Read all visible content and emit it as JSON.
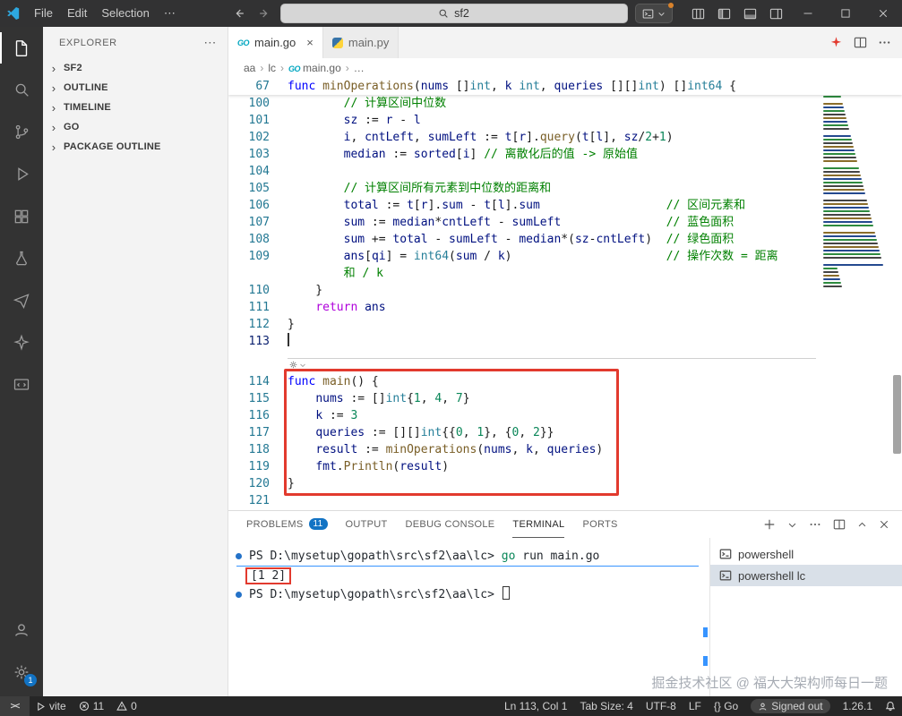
{
  "colors": {
    "annotation_red": "#e23a2e",
    "badge_blue": "#1273c4",
    "accent_blue": "#3794ff"
  },
  "title_bar": {
    "menus": [
      "File",
      "Edit",
      "Selection",
      "⋯"
    ],
    "search": "sf2"
  },
  "activity_bar": {
    "top": [
      {
        "name": "explorer",
        "active": true
      },
      {
        "name": "search"
      },
      {
        "name": "source-control"
      },
      {
        "name": "run-debug"
      },
      {
        "name": "extensions"
      },
      {
        "name": "test-flask"
      },
      {
        "name": "paper-plane"
      },
      {
        "name": "sparkle"
      },
      {
        "name": "remote-window"
      }
    ],
    "bottom": [
      {
        "name": "account"
      },
      {
        "name": "settings",
        "badge": "1"
      }
    ]
  },
  "sidebar": {
    "title": "EXPLORER",
    "more_label": "⋯",
    "chevron": "›",
    "sections": [
      {
        "label": "SF2"
      },
      {
        "label": "OUTLINE"
      },
      {
        "label": "TIMELINE"
      },
      {
        "label": "GO"
      },
      {
        "label": "PACKAGE OUTLINE"
      }
    ]
  },
  "editor": {
    "tabs": [
      {
        "label": "main.go",
        "icon": "go",
        "active": true
      },
      {
        "label": "main.py",
        "icon": "python"
      }
    ],
    "breadcrumb_sep": "›",
    "breadcrumb": [
      {
        "label": "aa"
      },
      {
        "label": "lc"
      },
      {
        "label": "main.go",
        "icon": "go"
      },
      {
        "label": "…"
      }
    ],
    "icon_labels": {
      "go": "GO"
    },
    "lines": [
      {
        "n": "67",
        "sticky": true,
        "tk": [
          [
            "k",
            "func "
          ],
          [
            "f",
            "minOperations"
          ],
          [
            "o",
            "("
          ],
          [
            "v",
            "nums"
          ],
          [
            "o",
            " []"
          ],
          [
            "t",
            "int"
          ],
          [
            "o",
            ", "
          ],
          [
            "v",
            "k"
          ],
          [
            "o",
            " "
          ],
          [
            "t",
            "int"
          ],
          [
            "o",
            ", "
          ],
          [
            "v",
            "queries"
          ],
          [
            "o",
            " [][]"
          ],
          [
            "t",
            "int"
          ],
          [
            "o",
            ") []"
          ],
          [
            "t",
            "int64"
          ],
          [
            "o",
            " {"
          ]
        ]
      },
      {
        "n": "100",
        "tk": [
          [
            "o",
            "        "
          ],
          [
            "c",
            "// 计算区间中位数"
          ]
        ]
      },
      {
        "n": "101",
        "tk": [
          [
            "o",
            "        "
          ],
          [
            "v",
            "sz"
          ],
          [
            "o",
            " := "
          ],
          [
            "v",
            "r"
          ],
          [
            "o",
            " - "
          ],
          [
            "v",
            "l"
          ]
        ]
      },
      {
        "n": "102",
        "tk": [
          [
            "o",
            "        "
          ],
          [
            "v",
            "i"
          ],
          [
            "o",
            ", "
          ],
          [
            "v",
            "cntLeft"
          ],
          [
            "o",
            ", "
          ],
          [
            "v",
            "sumLeft"
          ],
          [
            "o",
            " := "
          ],
          [
            "v",
            "t"
          ],
          [
            "o",
            "["
          ],
          [
            "v",
            "r"
          ],
          [
            "o",
            "]."
          ],
          [
            "f",
            "query"
          ],
          [
            "o",
            "("
          ],
          [
            "v",
            "t"
          ],
          [
            "o",
            "["
          ],
          [
            "v",
            "l"
          ],
          [
            "o",
            "], "
          ],
          [
            "v",
            "sz"
          ],
          [
            "o",
            "/"
          ],
          [
            "n",
            "2"
          ],
          [
            "o",
            "+"
          ],
          [
            "n",
            "1"
          ],
          [
            "o",
            ")"
          ]
        ]
      },
      {
        "n": "103",
        "tk": [
          [
            "o",
            "        "
          ],
          [
            "v",
            "median"
          ],
          [
            "o",
            " := "
          ],
          [
            "v",
            "sorted"
          ],
          [
            "o",
            "["
          ],
          [
            "v",
            "i"
          ],
          [
            "o",
            "] "
          ],
          [
            "c",
            "// 离散化后的值 -> 原始值"
          ]
        ]
      },
      {
        "n": "104",
        "tk": []
      },
      {
        "n": "105",
        "tk": [
          [
            "o",
            "        "
          ],
          [
            "c",
            "// 计算区间所有元素到中位数的距离和"
          ]
        ]
      },
      {
        "n": "106",
        "tk": [
          [
            "o",
            "        "
          ],
          [
            "v",
            "total"
          ],
          [
            "o",
            " := "
          ],
          [
            "v",
            "t"
          ],
          [
            "o",
            "["
          ],
          [
            "v",
            "r"
          ],
          [
            "o",
            "]."
          ],
          [
            "v",
            "sum"
          ],
          [
            "o",
            " - "
          ],
          [
            "v",
            "t"
          ],
          [
            "o",
            "["
          ],
          [
            "v",
            "l"
          ],
          [
            "o",
            "]."
          ],
          [
            "v",
            "sum"
          ],
          [
            "o",
            "                  "
          ],
          [
            "c",
            "// 区间元素和"
          ]
        ]
      },
      {
        "n": "107",
        "tk": [
          [
            "o",
            "        "
          ],
          [
            "v",
            "sum"
          ],
          [
            "o",
            " := "
          ],
          [
            "v",
            "median"
          ],
          [
            "o",
            "*"
          ],
          [
            "v",
            "cntLeft"
          ],
          [
            "o",
            " - "
          ],
          [
            "v",
            "sumLeft"
          ],
          [
            "o",
            "               "
          ],
          [
            "c",
            "// 蓝色面积"
          ]
        ]
      },
      {
        "n": "108",
        "tk": [
          [
            "o",
            "        "
          ],
          [
            "v",
            "sum"
          ],
          [
            "o",
            " += "
          ],
          [
            "v",
            "total"
          ],
          [
            "o",
            " - "
          ],
          [
            "v",
            "sumLeft"
          ],
          [
            "o",
            " - "
          ],
          [
            "v",
            "median"
          ],
          [
            "o",
            "*("
          ],
          [
            "v",
            "sz"
          ],
          [
            "o",
            "-"
          ],
          [
            "v",
            "cntLeft"
          ],
          [
            "o",
            ")"
          ],
          [
            "o",
            "  "
          ],
          [
            "c",
            "// 绿色面积"
          ]
        ]
      },
      {
        "n": "109",
        "tk": [
          [
            "o",
            "        "
          ],
          [
            "v",
            "ans"
          ],
          [
            "o",
            "["
          ],
          [
            "v",
            "qi"
          ],
          [
            "o",
            "] = "
          ],
          [
            "t",
            "int64"
          ],
          [
            "o",
            "("
          ],
          [
            "v",
            "sum"
          ],
          [
            "o",
            " / "
          ],
          [
            "v",
            "k"
          ],
          [
            "o",
            ")"
          ],
          [
            "o",
            "                      "
          ],
          [
            "c",
            "// 操作次数 = 距离"
          ]
        ]
      },
      {
        "wrap": true,
        "tk": [
          [
            "o",
            "        "
          ],
          [
            "c",
            "和 / k"
          ]
        ]
      },
      {
        "n": "110",
        "tk": [
          [
            "o",
            "    }"
          ]
        ]
      },
      {
        "n": "111",
        "tk": [
          [
            "o",
            "    "
          ],
          [
            "ctl",
            "return"
          ],
          [
            "o",
            " "
          ],
          [
            "v",
            "ans"
          ]
        ]
      },
      {
        "n": "112",
        "tk": [
          [
            "o",
            "}"
          ]
        ]
      },
      {
        "n": "113",
        "cursor": true,
        "tk": []
      },
      {
        "sep": true
      },
      {
        "n": "114",
        "boxed": true,
        "tk": [
          [
            "k",
            "func "
          ],
          [
            "f",
            "main"
          ],
          [
            "o",
            "() {"
          ]
        ]
      },
      {
        "n": "115",
        "boxed": true,
        "tk": [
          [
            "o",
            "    "
          ],
          [
            "v",
            "nums"
          ],
          [
            "o",
            " := []"
          ],
          [
            "t",
            "int"
          ],
          [
            "o",
            "{"
          ],
          [
            "n",
            "1"
          ],
          [
            "o",
            ", "
          ],
          [
            "n",
            "4"
          ],
          [
            "o",
            ", "
          ],
          [
            "n",
            "7"
          ],
          [
            "o",
            "}"
          ]
        ]
      },
      {
        "n": "116",
        "boxed": true,
        "tk": [
          [
            "o",
            "    "
          ],
          [
            "v",
            "k"
          ],
          [
            "o",
            " := "
          ],
          [
            "n",
            "3"
          ]
        ]
      },
      {
        "n": "117",
        "boxed": true,
        "tk": [
          [
            "o",
            "    "
          ],
          [
            "v",
            "queries"
          ],
          [
            "o",
            " := [][]"
          ],
          [
            "t",
            "int"
          ],
          [
            "o",
            "{{"
          ],
          [
            "n",
            "0"
          ],
          [
            "o",
            ", "
          ],
          [
            "n",
            "1"
          ],
          [
            "o",
            "}, {"
          ],
          [
            "n",
            "0"
          ],
          [
            "o",
            ", "
          ],
          [
            "n",
            "2"
          ],
          [
            "o",
            "}}"
          ]
        ]
      },
      {
        "n": "118",
        "boxed": true,
        "tk": [
          [
            "o",
            "    "
          ],
          [
            "v",
            "result"
          ],
          [
            "o",
            " := "
          ],
          [
            "f",
            "minOperations"
          ],
          [
            "o",
            "("
          ],
          [
            "v",
            "nums"
          ],
          [
            "o",
            ", "
          ],
          [
            "v",
            "k"
          ],
          [
            "o",
            ", "
          ],
          [
            "v",
            "queries"
          ],
          [
            "o",
            ")"
          ]
        ]
      },
      {
        "n": "119",
        "boxed": true,
        "tk": [
          [
            "o",
            "    "
          ],
          [
            "v",
            "fmt"
          ],
          [
            "o",
            "."
          ],
          [
            "f",
            "Println"
          ],
          [
            "o",
            "("
          ],
          [
            "v",
            "result"
          ],
          [
            "o",
            ")"
          ]
        ]
      },
      {
        "n": "120",
        "boxed": true,
        "tk": [
          [
            "o",
            "}"
          ]
        ]
      },
      {
        "n": "121",
        "tk": []
      }
    ]
  },
  "panel": {
    "tabs": [
      {
        "label": "PROBLEMS",
        "badge": "11"
      },
      {
        "label": "OUTPUT"
      },
      {
        "label": "DEBUG CONSOLE"
      },
      {
        "label": "TERMINAL",
        "active": true
      },
      {
        "label": "PORTS"
      }
    ],
    "terminal_lines": [
      {
        "dot": true,
        "ul": true,
        "tk": [
          [
            "def",
            "PS D:\\mysetup\\gopath\\src\\sf2\\aa\\lc> "
          ],
          [
            "cmd",
            "go"
          ],
          [
            "def",
            " run main.go"
          ]
        ]
      },
      {
        "tk": [
          [
            "boxed",
            "[1 2]"
          ]
        ]
      },
      {
        "dot": true,
        "cursor": true,
        "tk": [
          [
            "def",
            "PS D:\\mysetup\\gopath\\src\\sf2\\aa\\lc> "
          ]
        ]
      }
    ],
    "terminal_list": [
      {
        "label": "powershell"
      },
      {
        "label": "powershell lc",
        "active": true
      }
    ]
  },
  "status_bar": {
    "remote_label": "><",
    "left": [
      {
        "icon": "play",
        "label": "vite"
      },
      {
        "icon": "error",
        "label": "11"
      },
      {
        "icon": "warning",
        "label": "0"
      }
    ],
    "right": [
      {
        "label": "Ln 113, Col 1"
      },
      {
        "label": "Tab Size: 4"
      },
      {
        "label": "UTF-8"
      },
      {
        "label": "LF"
      },
      {
        "label": "{} Go"
      },
      {
        "icon": "person",
        "label": "Signed out",
        "pill": true
      },
      {
        "label": "1.26.1"
      },
      {
        "icon": "bell",
        "label": ""
      }
    ]
  },
  "watermark": "掘金技术社区 @ 福大大架构师每日一题"
}
